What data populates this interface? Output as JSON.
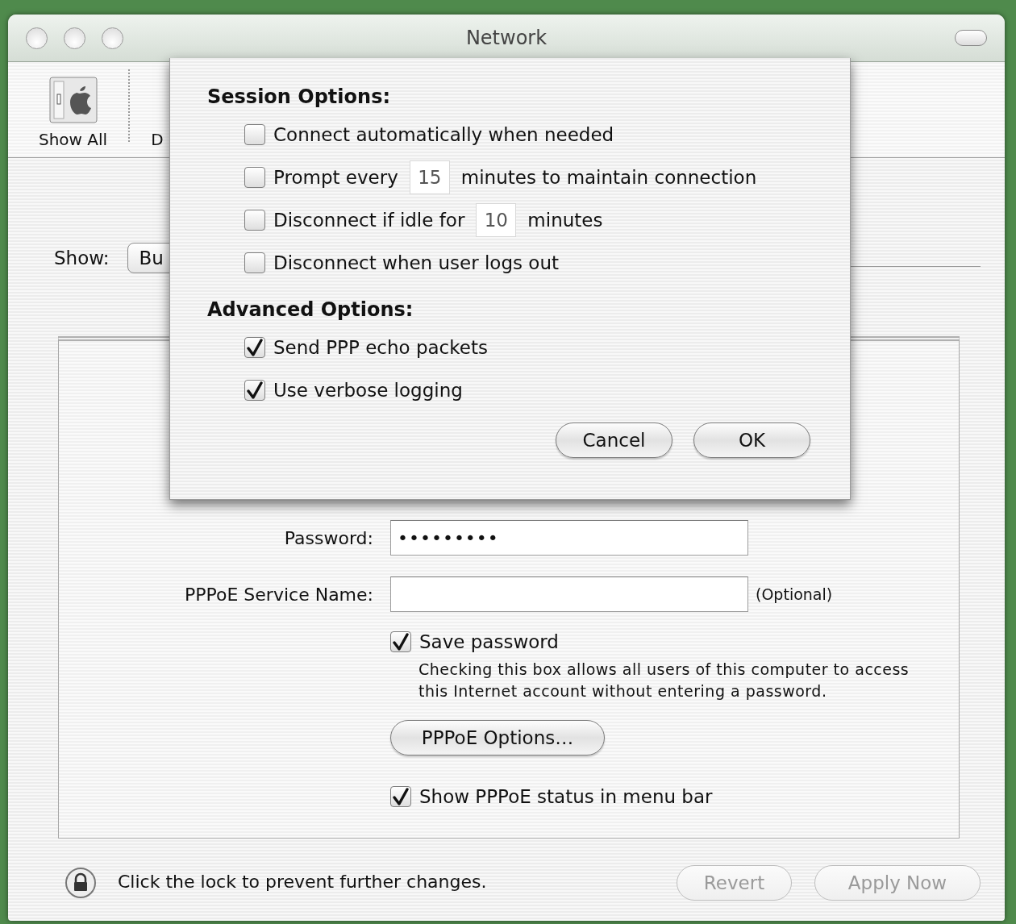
{
  "window": {
    "title": "Network"
  },
  "toolbar": {
    "items": [
      {
        "kind": "icon",
        "label": "Show All"
      },
      {
        "kind": "text",
        "label": "D"
      }
    ]
  },
  "show": {
    "label": "Show:",
    "value": "Bu"
  },
  "sheet": {
    "sections": [
      {
        "title": "Session Options:",
        "options": [
          {
            "kind": "plain",
            "label": "Connect automatically when needed",
            "checked": false
          },
          {
            "kind": "field",
            "before": "Prompt every",
            "value": "15",
            "after": "minutes to maintain connection",
            "checked": false
          },
          {
            "kind": "field",
            "before": "Disconnect if idle for",
            "value": "10",
            "after": "minutes",
            "checked": false
          },
          {
            "kind": "plain",
            "label": "Disconnect when user logs out",
            "checked": false
          }
        ]
      },
      {
        "title": "Advanced Options:",
        "options": [
          {
            "kind": "plain",
            "label": "Send PPP echo packets",
            "checked": true
          },
          {
            "kind": "plain",
            "label": "Use verbose logging",
            "checked": true
          }
        ]
      }
    ],
    "buttons": [
      {
        "label": "Cancel"
      },
      {
        "label": "OK"
      }
    ]
  },
  "form": {
    "fields": [
      {
        "label": "Password:",
        "value": "•••••••••"
      },
      {
        "label": "PPPoE Service Name:",
        "note": "(Optional)"
      }
    ]
  },
  "save_password": {
    "label": "Save password",
    "checked": true,
    "help": "Checking this box allows all users of this computer to access this Internet account without entering a password."
  },
  "options_button": {
    "label": "PPPoE Options…"
  },
  "show_status": {
    "label": "Show PPPoE status in menu bar",
    "checked": true
  },
  "footer": {
    "lock_text": "Click the lock to prevent further changes.",
    "buttons": [
      {
        "label": "Revert",
        "disabled": true
      },
      {
        "label": "Apply Now",
        "disabled": true
      }
    ]
  }
}
